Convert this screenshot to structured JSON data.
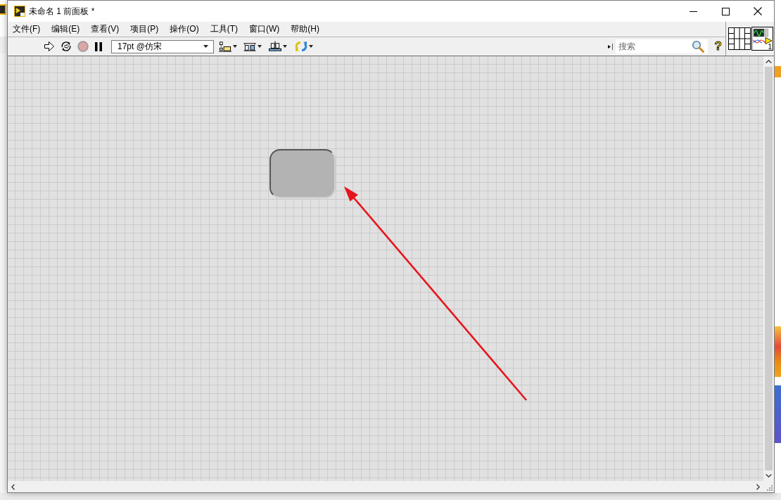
{
  "window": {
    "title": "未命名 1 前面板 *"
  },
  "menu": [
    {
      "label": "文件(F)"
    },
    {
      "label": "编辑(E)"
    },
    {
      "label": "查看(V)"
    },
    {
      "label": "项目(P)"
    },
    {
      "label": "操作(O)"
    },
    {
      "label": "工具(T)"
    },
    {
      "label": "窗口(W)"
    },
    {
      "label": "帮助(H)"
    }
  ],
  "toolbar": {
    "abort": {
      "disabled": true
    },
    "font": "17pt @仿宋",
    "search": {
      "placeholder": "搜索"
    },
    "help": "?"
  },
  "vi_icon": {
    "number": "1"
  },
  "front_panel": {
    "objects": [
      {
        "kind": "rounded_box"
      }
    ],
    "annotations": [
      {
        "kind": "arrow"
      }
    ]
  }
}
